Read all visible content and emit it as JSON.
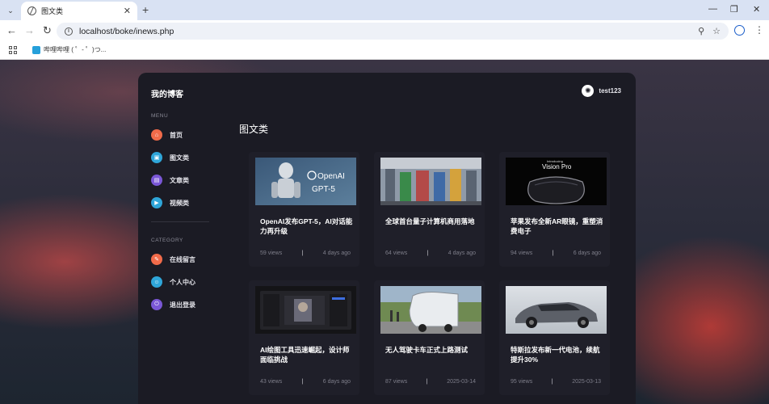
{
  "browser": {
    "tab_title": "图文类",
    "tab_close": "✕",
    "new_tab": "+",
    "url": "localhost/boke/inews.php",
    "bookmark_label": "哔哩哔哩 ( ゜- ゜)つ..."
  },
  "site": {
    "brand": "我的博客",
    "user_name": "test123"
  },
  "sidebar": {
    "menu_label": "MENU",
    "menu": [
      {
        "label": "首页",
        "color": "#f16b4a",
        "icon": "home-icon"
      },
      {
        "label": "图文类",
        "color": "#2fa6d9",
        "icon": "image-icon"
      },
      {
        "label": "文章类",
        "color": "#7a57d6",
        "icon": "document-icon"
      },
      {
        "label": "视频类",
        "color": "#2fa6d9",
        "icon": "video-icon"
      }
    ],
    "category_label": "CATEGORY",
    "category": [
      {
        "label": "在线留言",
        "color": "#f16b4a",
        "icon": "message-icon"
      },
      {
        "label": "个人中心",
        "color": "#2fa6d9",
        "icon": "user-icon"
      },
      {
        "label": "退出登录",
        "color": "#7a57d6",
        "icon": "logout-icon"
      }
    ]
  },
  "main": {
    "title": "图文类",
    "cards": [
      {
        "title": "OpenAI发布GPT-5，AI对话能力再升级",
        "views": "59 views",
        "date": "4 days ago",
        "thumb_line1": "OpenAI",
        "thumb_line2": "GPT-5"
      },
      {
        "title": "全球首台量子计算机商用落地",
        "views": "64 views",
        "date": "4 days ago"
      },
      {
        "title": "苹果发布全新AR眼镜，重塑消费电子",
        "views": "94 views",
        "date": "6 days ago",
        "thumb_line1": "Introducing",
        "thumb_line2": "Vision Pro"
      },
      {
        "title": "AI绘图工具迅速崛起，设计师面临挑战",
        "views": "43 views",
        "date": "6 days ago"
      },
      {
        "title": "无人驾驶卡车正式上路测试",
        "views": "87 views",
        "date": "2025-03-14"
      },
      {
        "title": "特斯拉发布新一代电池，续航提升30%",
        "views": "95 views",
        "date": "2025-03-13"
      }
    ]
  }
}
